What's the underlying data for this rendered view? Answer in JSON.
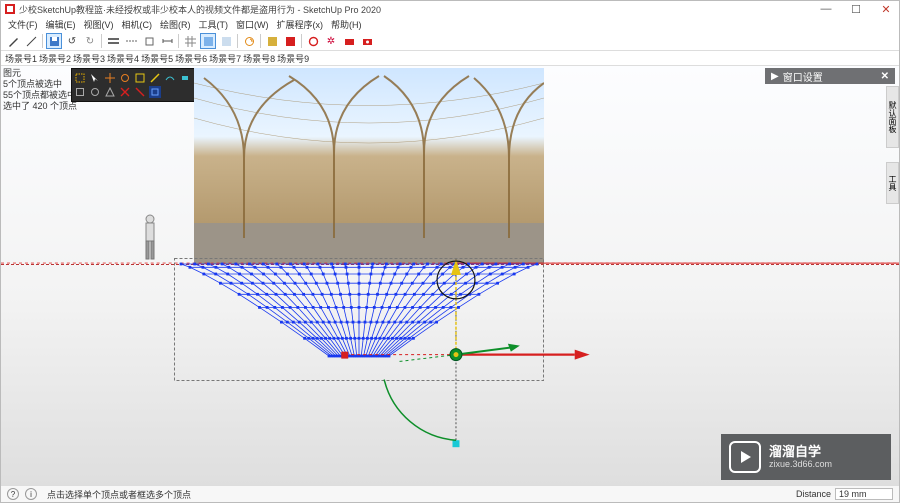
{
  "title": "少校SketchUp教程篮·未经授权或非少校本人的视频文件都是盗用行为 - SketchUp Pro 2020",
  "menus": [
    "文件(F)",
    "编辑(E)",
    "视图(V)",
    "相机(C)",
    "绘图(R)",
    "工具(T)",
    "窗口(W)",
    "扩展程序(x)",
    "帮助(H)"
  ],
  "views": [
    "场景号1",
    "场景号2",
    "场景号3",
    "场景号4",
    "场景号5",
    "场景号6",
    "场景号7",
    "场景号8",
    "场景号9"
  ],
  "info": {
    "l1": "图元",
    "l2": "5个顶点被选中",
    "l3": "55个顶点都被选中",
    "l4": "选中了 420 个顶点"
  },
  "floating": {
    "title": "窗口设置"
  },
  "vstrip1": "默认面板",
  "vstrip2": "工具",
  "status": {
    "hint": "点击选择单个顶点或者框选多个顶点",
    "dist_label": "Distance",
    "dist_value": "19 mm"
  },
  "watermark": {
    "brand": "溜溜自学",
    "url": "zixue.3d66.com"
  },
  "icons": {
    "pencil": "✎",
    "box": "▭",
    "select": "⬚",
    "save": "🖫",
    "undo": "↺",
    "redo": "↻",
    "layers": "▤",
    "align": "≡",
    "rotate": "⟳",
    "record": "●",
    "gear": "⚙",
    "info": "ⓘ"
  },
  "colors": {
    "red": "#d61f1f",
    "green": "#0e8f2a",
    "blue": "#1838f0",
    "yellow": "#e6c314",
    "cyan": "#18c9d6",
    "brown": "#8a6a3a",
    "black": "#111"
  }
}
